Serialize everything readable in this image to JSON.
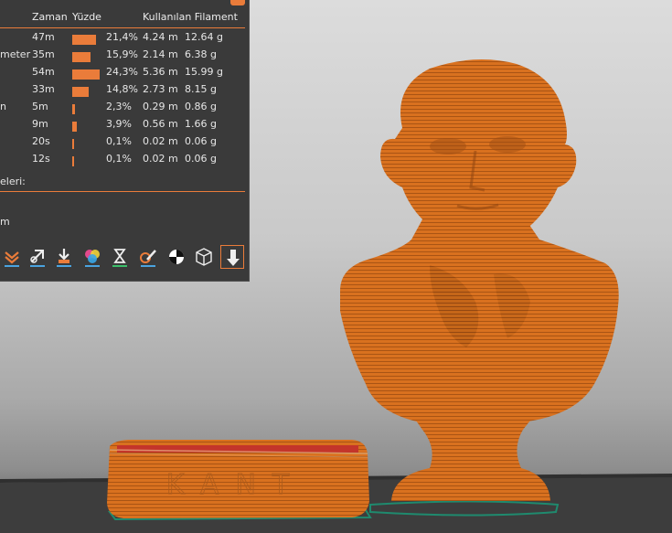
{
  "stats_table": {
    "headers": {
      "time": "Zaman",
      "percent": "Yüzde",
      "used_filament": "Kullanılan Filament"
    },
    "rows": [
      {
        "name": "",
        "time": "47m",
        "percent_value": 21.4,
        "percent": "21,4%",
        "length": "4.24 m",
        "weight": "12.64 g"
      },
      {
        "name": "meter",
        "time": "35m",
        "percent_value": 15.9,
        "percent": "15,9%",
        "length": "2.14 m",
        "weight": "6.38 g"
      },
      {
        "name": "",
        "time": "54m",
        "percent_value": 24.3,
        "percent": "24,3%",
        "length": "5.36 m",
        "weight": "15.99 g"
      },
      {
        "name": "",
        "time": "33m",
        "percent_value": 14.8,
        "percent": "14,8%",
        "length": "2.73 m",
        "weight": "8.15 g"
      },
      {
        "name": "n",
        "time": "5m",
        "percent_value": 2.3,
        "percent": "2,3%",
        "length": "0.29 m",
        "weight": "0.86 g"
      },
      {
        "name": "",
        "time": "9m",
        "percent_value": 3.9,
        "percent": "3,9%",
        "length": "0.56 m",
        "weight": "1.66 g"
      },
      {
        "name": "",
        "time": "20s",
        "percent_value": 0.1,
        "percent": "0,1%",
        "length": "0.02 m",
        "weight": "0.06 g"
      },
      {
        "name": "",
        "time": "12s",
        "percent_value": 0.1,
        "percent": "0,1%",
        "length": "0.02 m",
        "weight": "0.06 g"
      }
    ],
    "extrusion_label": "eleri:",
    "partial_bottom": "m"
  },
  "toolbar": {
    "icons": [
      "layers-chevron-icon",
      "retractions-icon",
      "seams-icon",
      "color-changes-icon",
      "pause-icon",
      "custom-gcode-icon",
      "center-of-gravity-icon",
      "shells-icon",
      "tool-marker-icon"
    ]
  },
  "model": {
    "base_label": "KANT"
  },
  "colors": {
    "accent": "#ea7c3a",
    "panel_bg": "#3a3a3a",
    "filament": "#d96f1c"
  }
}
